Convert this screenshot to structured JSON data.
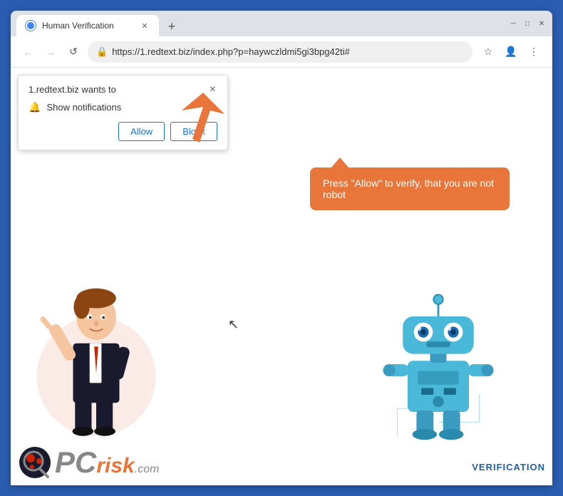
{
  "browser": {
    "tab": {
      "title": "Human Verification",
      "favicon_alt": "globe-favicon"
    },
    "window_controls": {
      "minimize": "─",
      "maximize": "□",
      "close": "✕"
    },
    "nav": {
      "back": "←",
      "forward": "→",
      "refresh": "↺"
    },
    "address_bar": {
      "url": "https://1.redtext.biz/index.php?p=haywczldmi5gi3bpg42ti#",
      "lock_icon": "🔒"
    },
    "address_actions": {
      "star": "☆",
      "profile": "👤",
      "menu": "⋮"
    }
  },
  "notification_popup": {
    "site_text": "1.redtext.biz wants to",
    "close_label": "×",
    "notification_label": "Show notifications",
    "allow_label": "Allow",
    "block_label": "Block"
  },
  "speech_bubble": {
    "text": "Press \"Allow\" to verify, that you are not robot"
  },
  "footer": {
    "logo_pc": "PC",
    "logo_risk": "risk",
    "logo_com": ".com",
    "verification": "VERIFICATION"
  }
}
